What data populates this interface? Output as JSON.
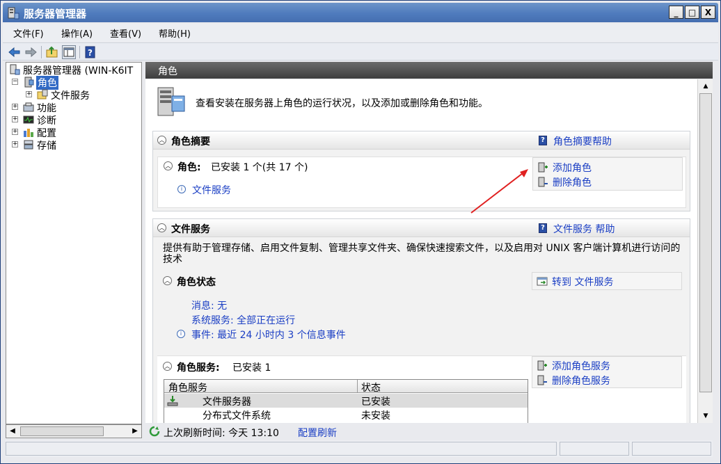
{
  "window": {
    "title": "服务器管理器",
    "controls": [
      "_",
      "□",
      "X"
    ]
  },
  "menubar": [
    "文件(F)",
    "操作(A)",
    "查看(V)",
    "帮助(H)"
  ],
  "toolbar": {
    "icons": [
      "back-arrow-icon",
      "forward-arrow-icon",
      "up-folder-icon",
      "show-hide-tree-icon",
      "help-icon"
    ]
  },
  "tree": {
    "root": "服务器管理器 (WIN-K6IT",
    "items": [
      {
        "label": "角色",
        "expander": "−",
        "selected": true
      },
      {
        "label": "文件服务",
        "expander": "+"
      },
      {
        "label": "功能",
        "expander": "+"
      },
      {
        "label": "诊断",
        "expander": "+"
      },
      {
        "label": "配置",
        "expander": "+"
      },
      {
        "label": "存储",
        "expander": "+"
      }
    ]
  },
  "right": {
    "header": "角色",
    "intro": "查看安装在服务器上角色的运行状况，以及添加或删除角色和功能。",
    "summary": {
      "title": "角色摘要",
      "help": "角色摘要帮助",
      "roles_label": "角色:",
      "roles_value": "已安装 1 个(共 17 个)",
      "installed_role": "文件服务",
      "actions": [
        "添加角色",
        "删除角色"
      ]
    },
    "file_services": {
      "title": "文件服务",
      "help": "文件服务 帮助",
      "description": "提供有助于管理存储、启用文件复制、管理共享文件夹、确保快速搜索文件，以及启用对 UNIX 客户端计算机进行访问的技术",
      "role_status": {
        "title": "角色状态",
        "action": "转到 文件服务",
        "messages": "消息: 无",
        "system_services": "系统服务: 全部正在运行",
        "events": "事件: 最近 24 小时内 3 个信息事件"
      },
      "role_services": {
        "title": "角色服务:",
        "installed": "已安装 1",
        "actions": [
          "添加角色服务",
          "删除角色服务"
        ],
        "columns": [
          "角色服务",
          "状态"
        ],
        "rows": [
          {
            "name": "文件服务器",
            "status": "已安装"
          },
          {
            "name": "分布式文件系统",
            "status": "未安装"
          }
        ]
      }
    }
  },
  "footer": {
    "refresh_label": "上次刷新时间: 今天 13:10",
    "refresh_link": "配置刷新"
  }
}
